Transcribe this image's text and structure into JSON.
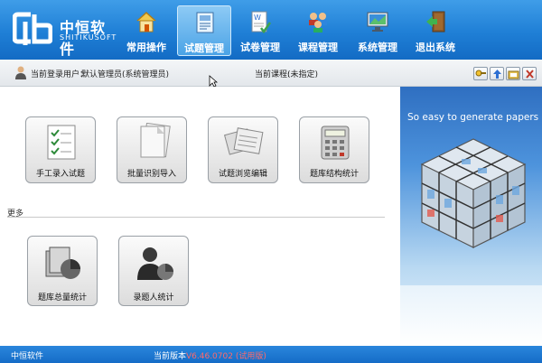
{
  "header": {
    "logo_cn": "中恒软件",
    "logo_en": "SHITIKUSOFT",
    "nav": [
      {
        "label": "常用操作",
        "icon": "home-icon"
      },
      {
        "label": "试题管理",
        "icon": "document-icon",
        "active": true
      },
      {
        "label": "试卷管理",
        "icon": "exam-paper-icon"
      },
      {
        "label": "课程管理",
        "icon": "users-group-icon"
      },
      {
        "label": "系统管理",
        "icon": "monitor-icon"
      },
      {
        "label": "退出系统",
        "icon": "exit-door-icon"
      }
    ]
  },
  "infobar": {
    "user_label": "当前登录用户：",
    "user_value": "默认管理员(系统管理员)",
    "course_label": "当前课程:",
    "course_value": "(未指定)",
    "tools": [
      "search-key-icon",
      "upload-arrow-icon",
      "folder-icon",
      "close-icon"
    ]
  },
  "main": {
    "tiles": [
      {
        "label": "手工录入试题",
        "icon": "checklist-icon"
      },
      {
        "label": "批量识别导入",
        "icon": "paper-stack-icon"
      },
      {
        "label": "试题浏览编辑",
        "icon": "newspapers-icon"
      },
      {
        "label": "题库结构统计",
        "icon": "calculator-icon"
      }
    ],
    "more_label": "更多",
    "more_tiles": [
      {
        "label": "题库总量统计",
        "icon": "pie-chart-files-icon"
      },
      {
        "label": "录题人统计",
        "icon": "person-chart-icon"
      }
    ]
  },
  "banner": {
    "tagline": "So easy to generate papers"
  },
  "status": {
    "left": "中恒软件",
    "version_label": "当前版本",
    "version_value": "V6.46.0702 (试用版)"
  },
  "colors": {
    "header_top": "#3f9de8",
    "header_bottom": "#136bc4",
    "status_bar": "#1f78d1",
    "version_red": "#ff6a6a"
  }
}
